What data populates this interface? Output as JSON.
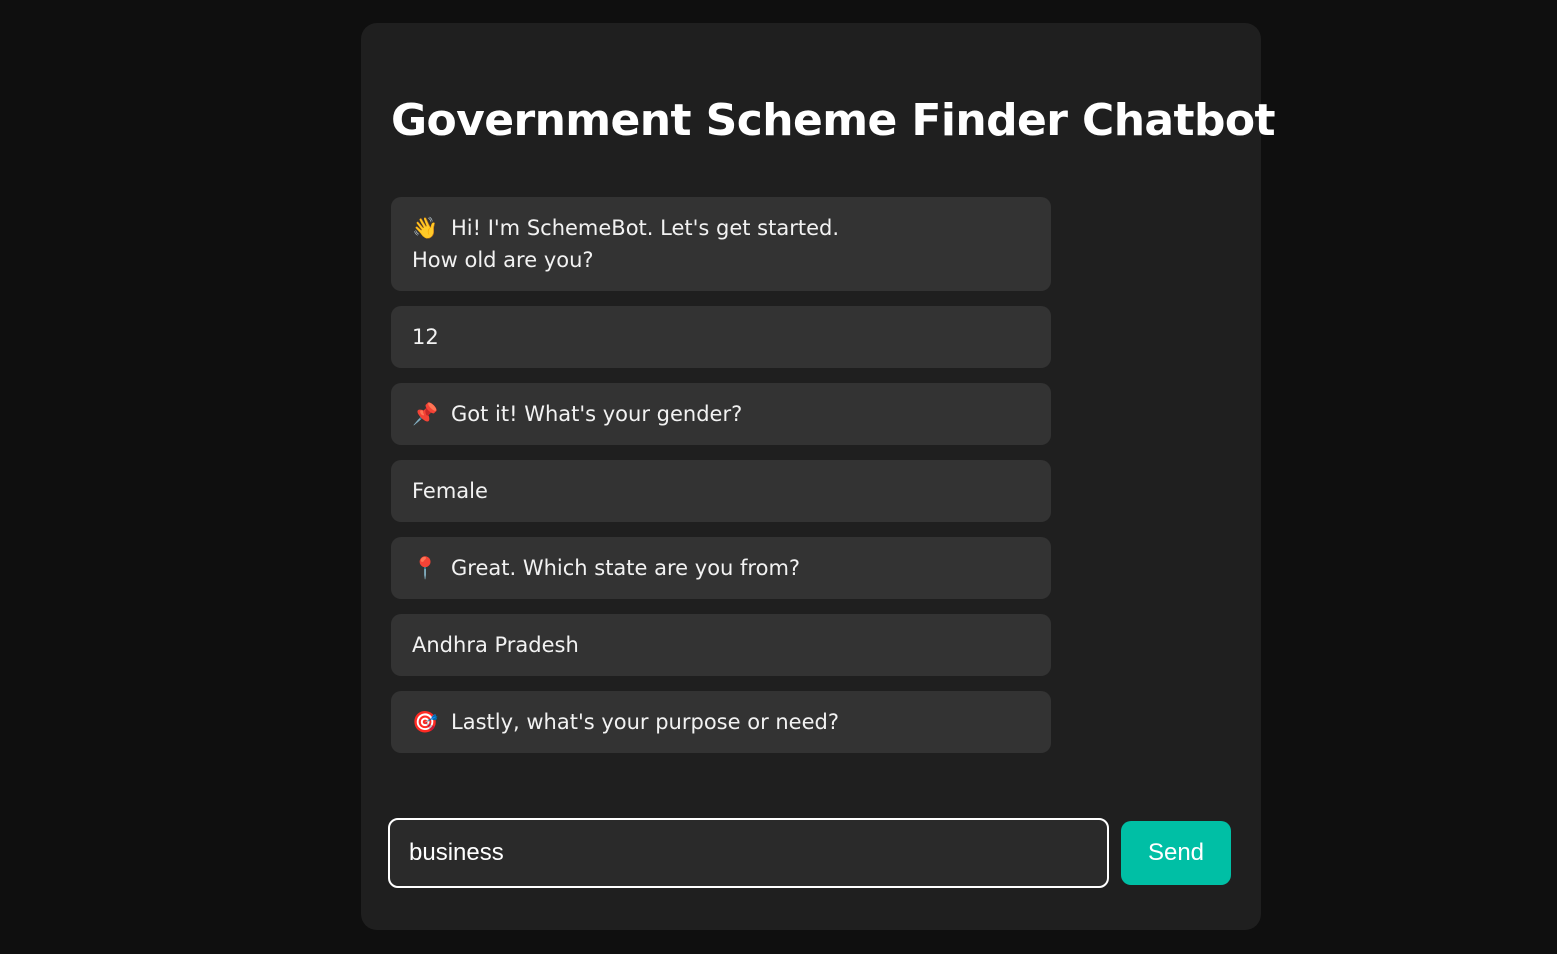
{
  "app": {
    "title": "Government Scheme Finder Chatbot"
  },
  "messages": [
    {
      "sender": "bot",
      "icon": "👋",
      "icon_name": "waving-hand-icon",
      "text": "Hi! I'm SchemeBot. Let's get started.\nHow old are you?"
    },
    {
      "sender": "user",
      "text": "12"
    },
    {
      "sender": "bot",
      "icon": "📌",
      "icon_name": "pushpin-icon",
      "text": "Got it! What's your gender?"
    },
    {
      "sender": "user",
      "text": "Female"
    },
    {
      "sender": "bot",
      "icon": "📍",
      "icon_name": "round-pushpin-icon",
      "text": "Great. Which state are you from?"
    },
    {
      "sender": "user",
      "text": "Andhra Pradesh"
    },
    {
      "sender": "bot",
      "icon": "🎯",
      "icon_name": "target-icon",
      "text": "Lastly, what's your purpose or need?"
    }
  ],
  "input": {
    "value": "business"
  },
  "send": {
    "label": "Send"
  },
  "colors": {
    "page_background": "#0f0f0f",
    "card_background": "#1f1f1f",
    "bubble_background": "#333333",
    "accent": "#00bfa5"
  }
}
